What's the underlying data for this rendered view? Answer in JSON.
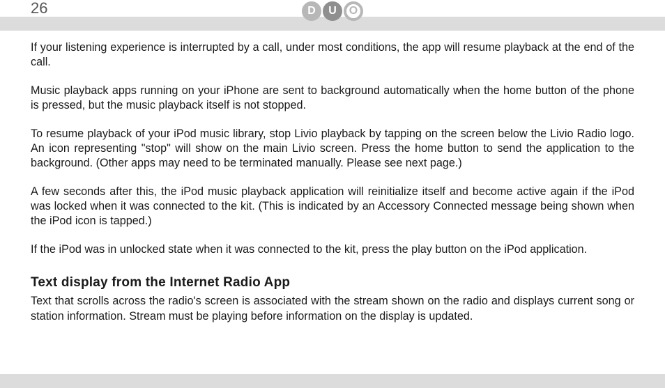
{
  "header": {
    "page_number": "26",
    "logo_letters": {
      "d": "D",
      "u": "U",
      "o": "O"
    }
  },
  "body": {
    "paragraphs": [
      "If your listening experience is interrupted by a call, under most conditions, the app will resume playback at the end of the call.",
      "Music playback apps running on your iPhone are sent to background automatically when the home button of the phone is pressed, but the music playback itself is not stopped.",
      "To resume playback of your iPod music library, stop Livio playback by tapping on the screen below the Livio Radio logo.  An icon representing \"stop\" will show on the main Livio screen. Press the home button to send the application to the background. (Other apps may need to be terminated manually. Please see next page.)",
      "A few seconds after this, the iPod music playback application will reinitialize itself and become active again if the iPod was locked when it was connected to the kit. (This is indicated by an Accessory Connected message being shown when the iPod icon is tapped.)",
      "If the iPod was in unlocked state when it was connected to the kit, press the play button on the iPod application."
    ],
    "section_heading": "Text display from the Internet Radio App",
    "section_paragraph": "Text that scrolls across the radio's screen is associated with the stream shown on the radio and displays current song or station information. Stream must be playing before information on the display is updated."
  }
}
